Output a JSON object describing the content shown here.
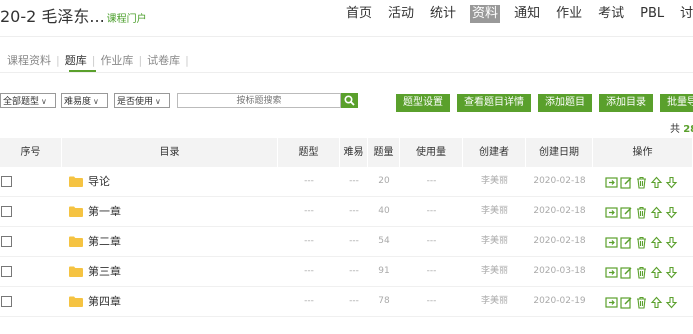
{
  "header": {
    "course_title": "20-2 毛泽东...",
    "portal_link": "课程门户",
    "nav": [
      {
        "label": "首页",
        "active": false
      },
      {
        "label": "活动",
        "active": false
      },
      {
        "label": "统计",
        "active": false
      },
      {
        "label": "资料",
        "active": true
      },
      {
        "label": "通知",
        "active": false
      },
      {
        "label": "作业",
        "active": false
      },
      {
        "label": "考试",
        "active": false
      },
      {
        "label": "PBL",
        "active": false
      },
      {
        "label": "讨论",
        "active": false
      }
    ]
  },
  "subtabs": [
    {
      "label": "课程资料",
      "active": false
    },
    {
      "label": "题库",
      "active": true
    },
    {
      "label": "作业库",
      "active": false
    },
    {
      "label": "试卷库",
      "active": false
    }
  ],
  "filters": {
    "type": "全部题型",
    "difficulty": "难易度",
    "usage": "是否使用",
    "search_placeholder": "按标题搜索"
  },
  "buttons": {
    "type_settings": "题型设置",
    "view_details": "查看题目详情",
    "add_question": "添加题目",
    "add_directory": "添加目录",
    "batch_import": "批量导入"
  },
  "total_prefix": "共",
  "total_count": "28",
  "columns": {
    "index": "序号",
    "directory": "目录",
    "type": "题型",
    "difficulty": "难易",
    "count": "题量",
    "usage": "使用量",
    "creator": "创建者",
    "created": "创建日期",
    "actions": "操作"
  },
  "rows": [
    {
      "name": "导论",
      "type": "---",
      "difficulty": "---",
      "count": "20",
      "usage": "---",
      "creator": "李美丽",
      "date": "2020-02-18"
    },
    {
      "name": "第一章",
      "type": "---",
      "difficulty": "---",
      "count": "40",
      "usage": "---",
      "creator": "李美丽",
      "date": "2020-02-18"
    },
    {
      "name": "第二章",
      "type": "---",
      "difficulty": "---",
      "count": "54",
      "usage": "---",
      "creator": "李美丽",
      "date": "2020-02-18"
    },
    {
      "name": "第三章",
      "type": "---",
      "difficulty": "---",
      "count": "91",
      "usage": "---",
      "creator": "李美丽",
      "date": "2020-03-18"
    },
    {
      "name": "第四章",
      "type": "---",
      "difficulty": "---",
      "count": "78",
      "usage": "---",
      "creator": "李美丽",
      "date": "2020-02-19"
    }
  ],
  "row_actions": [
    "move-icon",
    "edit-icon",
    "delete-icon",
    "move-up-icon",
    "move-down-icon"
  ],
  "colors": {
    "accent": "#5aa02c",
    "folder": "#f5c342",
    "header_bg": "#f3f3f3"
  }
}
